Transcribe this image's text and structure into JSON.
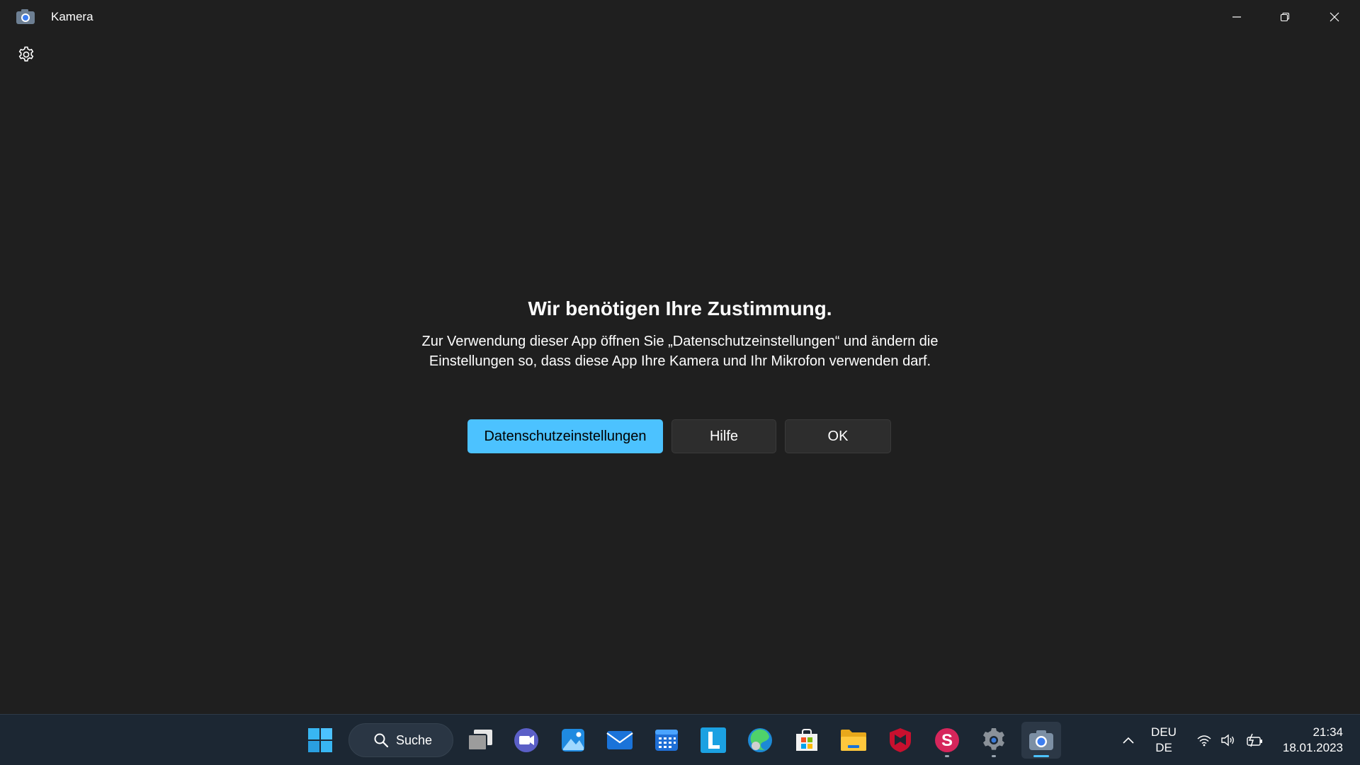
{
  "window": {
    "title": "Kamera",
    "controls": {
      "minimize": "minimize",
      "restore": "restore",
      "close": "close"
    }
  },
  "dialog": {
    "heading": "Wir benötigen Ihre Zustimmung.",
    "message": "Zur Verwendung dieser App öffnen Sie „Datenschutzeinstellungen“ und ändern die Einstellungen so, dass diese App Ihre Kamera und Ihr Mikrofon verwenden darf.",
    "buttons": {
      "privacy": "Datenschutzeinstellungen",
      "help": "Hilfe",
      "ok": "OK"
    }
  },
  "taskbar": {
    "search_label": "Suche",
    "apps": [
      "start-icon",
      "task-view-icon",
      "teams-icon",
      "photos-icon",
      "mail-icon",
      "calendar-icon",
      "l-app-icon",
      "edge-icon",
      "store-icon",
      "file-explorer-icon",
      "mcafee-icon",
      "s-app-icon",
      "settings-icon",
      "camera-icon"
    ],
    "language": {
      "line1": "DEU",
      "line2": "DE"
    },
    "clock": {
      "time": "21:34",
      "date": "18.01.2023"
    }
  },
  "colors": {
    "background": "#1f1f1f",
    "accent": "#4cc2ff",
    "taskbar": "#1c2733"
  }
}
